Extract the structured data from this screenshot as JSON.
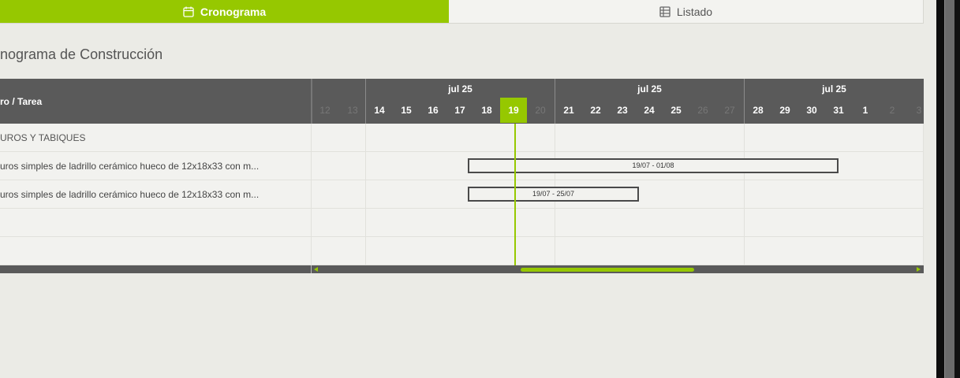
{
  "tabs": [
    {
      "label": "Cronograma",
      "icon": "calendar-icon",
      "active": true
    },
    {
      "label": "Listado",
      "icon": "table-icon",
      "active": false
    }
  ],
  "title": "nograma de Construcción",
  "gantt": {
    "task_header": "ro / Tarea",
    "weeks": [
      {
        "label": ""
      },
      {
        "label": "jul 25"
      },
      {
        "label": "jul 25"
      },
      {
        "label": "jul 25"
      }
    ],
    "days": [
      {
        "label": "12",
        "weekend": true
      },
      {
        "label": "13",
        "weekend": true
      },
      {
        "label": "14"
      },
      {
        "label": "15"
      },
      {
        "label": "16"
      },
      {
        "label": "17"
      },
      {
        "label": "18"
      },
      {
        "label": "19",
        "today": true
      },
      {
        "label": "20",
        "weekend": true
      },
      {
        "label": "21"
      },
      {
        "label": "22"
      },
      {
        "label": "23"
      },
      {
        "label": "24"
      },
      {
        "label": "25"
      },
      {
        "label": "26",
        "weekend": true
      },
      {
        "label": "27",
        "weekend": true
      },
      {
        "label": "28"
      },
      {
        "label": "29"
      },
      {
        "label": "30"
      },
      {
        "label": "31"
      },
      {
        "label": "1"
      },
      {
        "label": "2",
        "weekend": true
      },
      {
        "label": "3",
        "weekend": true
      }
    ],
    "rows": [
      {
        "label": "UROS Y TABIQUES",
        "type": "chapter"
      },
      {
        "label": "uros simples de ladrillo cerámico hueco de 12x18x33 con m...",
        "type": "task",
        "bar_label": "19/07 - 01/08"
      },
      {
        "label": "uros simples de ladrillo cerámico hueco de 12x18x33 con m...",
        "type": "task",
        "bar_label": "19/07 - 25/07"
      },
      {
        "label": "",
        "type": "empty"
      },
      {
        "label": "",
        "type": "empty"
      }
    ]
  },
  "colors": {
    "accent": "#96c800",
    "header_bg": "#5a5a5a",
    "body_bg": "#f2f2ef",
    "page_bg": "#ebebe6"
  }
}
